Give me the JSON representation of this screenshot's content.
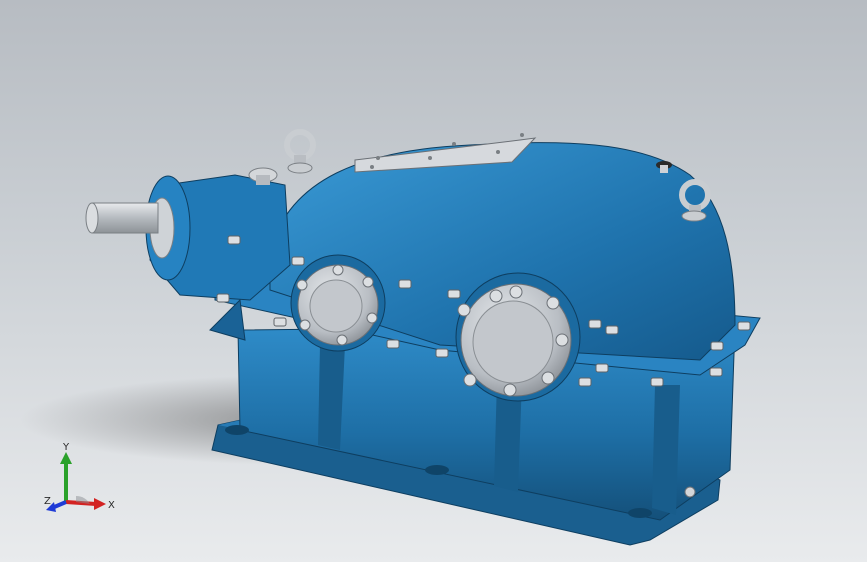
{
  "viewport": {
    "background_top": "#b7bcc2",
    "background_bottom": "#e9ebed"
  },
  "model": {
    "body_color": "#1e6fa6",
    "body_light": "#2f8cc9",
    "body_dark": "#14507a",
    "metal_color": "#c7cbd0",
    "bolt_color": "#d9dcdf",
    "icon": "gearbox-reducer-model"
  },
  "triad": {
    "x_label": "X",
    "y_label": "Y",
    "z_label": "Z",
    "x_color": "#d32222",
    "y_color": "#2aa12a",
    "z_color": "#1f3bd6"
  }
}
